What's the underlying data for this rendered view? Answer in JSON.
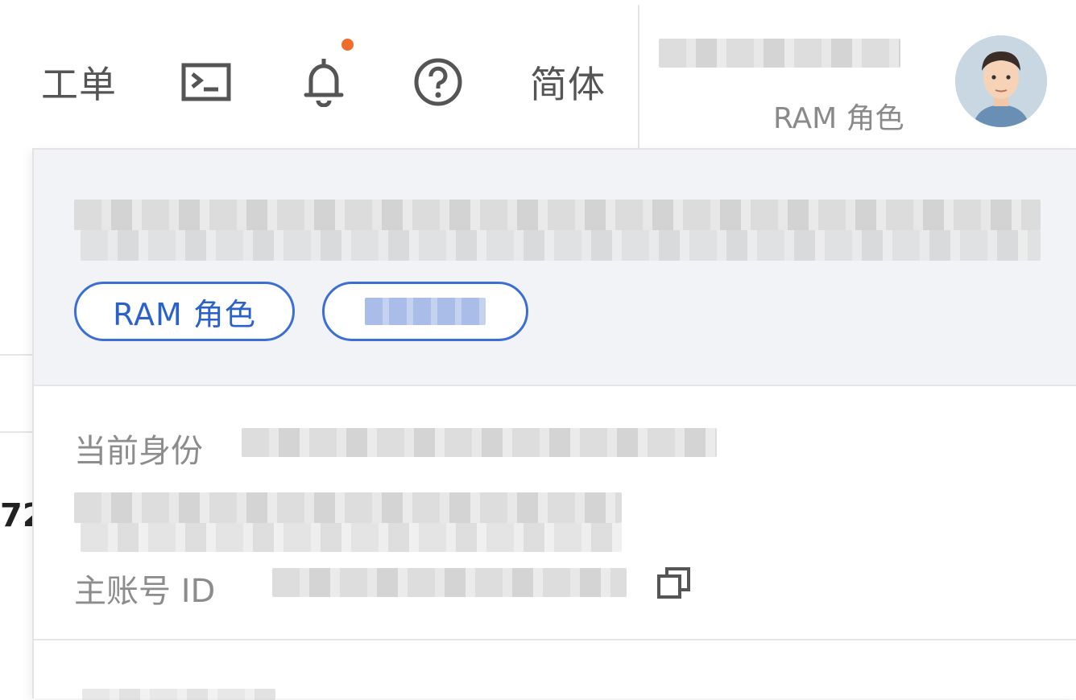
{
  "topbar": {
    "work_order": "工单",
    "terminal_icon": "terminal-icon",
    "bell_icon": "bell-icon",
    "help_icon": "help-circle-icon",
    "language": "简体",
    "role_label": "RAM 角色"
  },
  "panel": {
    "tags": [
      "RAM 角色"
    ],
    "identity_label": "当前身份",
    "main_account_label": "主账号 ID",
    "copy_icon": "copy-icon"
  },
  "background": {
    "fragment_text": "72"
  },
  "colors": {
    "accent": "#3b6fd4",
    "notification_dot": "#ef6c2b",
    "panel_header_bg": "#f1f3f6",
    "muted_text": "#8c8c8c"
  }
}
